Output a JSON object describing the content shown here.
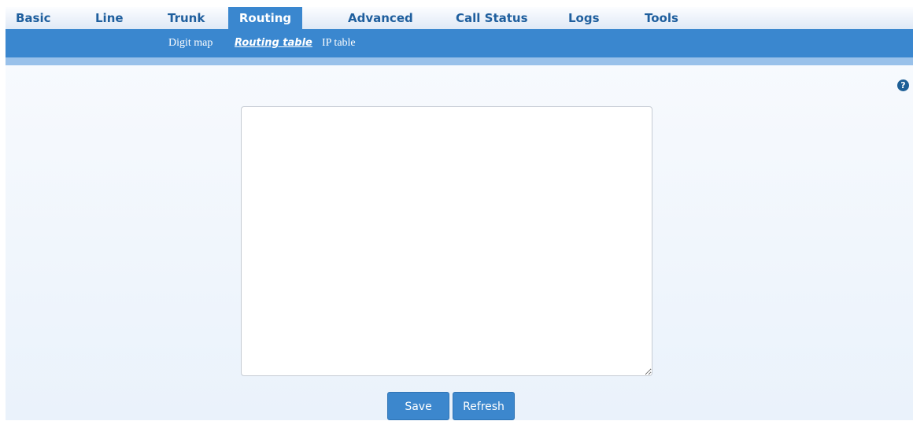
{
  "top_nav": {
    "tabs": [
      {
        "label": "Basic"
      },
      {
        "label": "Line"
      },
      {
        "label": "Trunk"
      },
      {
        "label": "Routing"
      },
      {
        "label": "Advanced"
      },
      {
        "label": "Call Status"
      },
      {
        "label": "Logs"
      },
      {
        "label": "Tools"
      }
    ],
    "active": "Routing"
  },
  "sub_nav": {
    "items": [
      {
        "label": "Digit map"
      },
      {
        "label": "Routing table"
      },
      {
        "label": "IP table"
      }
    ],
    "current": "Routing table"
  },
  "help": {
    "icon": "question-circle-icon",
    "glyph": "?"
  },
  "routing_table": {
    "value": ""
  },
  "actions": {
    "save_label": "Save",
    "refresh_label": "Refresh"
  },
  "colors": {
    "accent": "#3a87cf",
    "nav_text": "#1f5f9e",
    "stripe": "#99c1ea",
    "button": "#3c87cd"
  }
}
